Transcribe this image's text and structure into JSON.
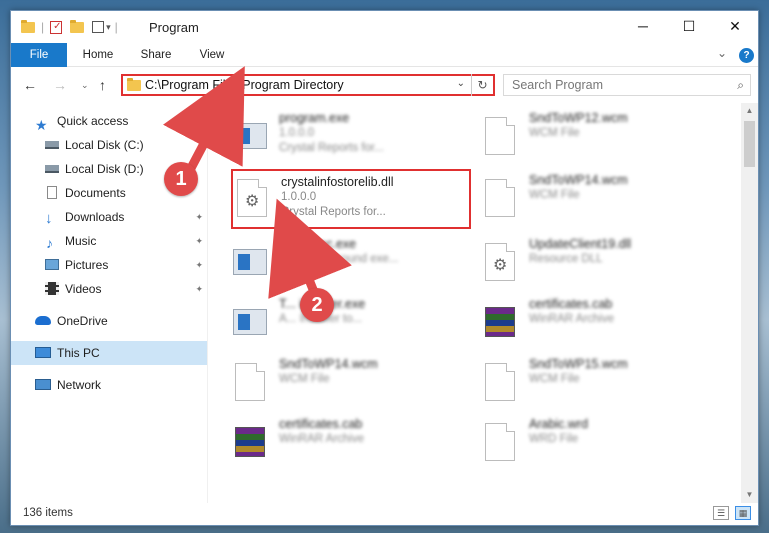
{
  "window": {
    "title": "Program",
    "min_glyph": "─",
    "max_glyph": "☐",
    "close_glyph": "✕"
  },
  "ribbon": {
    "tabs": [
      "File",
      "Home",
      "Share",
      "View"
    ],
    "expand_glyph": "⌄",
    "help_glyph": "?"
  },
  "navigation": {
    "back_glyph": "←",
    "forward_glyph": "→",
    "up_glyph": "↑",
    "address": "C:\\Program Files\\Program Directory",
    "dropdown_glyph": "⌄",
    "refresh_glyph": "↻",
    "search_placeholder": "Search Program",
    "search_glyph": "⌕"
  },
  "sidebar": {
    "items": [
      {
        "label": "Quick access",
        "icon": "star-icon"
      },
      {
        "label": "Local Disk (C:)",
        "icon": "drive-icon"
      },
      {
        "label": "Local Disk (D:)",
        "icon": "drive-icon"
      },
      {
        "label": "Documents",
        "icon": "documents-icon"
      },
      {
        "label": "Downloads",
        "icon": "download-icon"
      },
      {
        "label": "Music",
        "icon": "music-icon"
      },
      {
        "label": "Pictures",
        "icon": "pictures-icon"
      },
      {
        "label": "Videos",
        "icon": "videos-icon"
      },
      {
        "label": "OneDrive",
        "icon": "cloud-icon"
      },
      {
        "label": "This PC",
        "icon": "computer-icon"
      },
      {
        "label": "Network",
        "icon": "network-icon"
      }
    ],
    "pin_glyph": "📌"
  },
  "files": {
    "left": [
      {
        "name": "program.exe",
        "sub1": "1.0.0.0",
        "sub2": "Crystal Reports for..."
      },
      {
        "name": "crystalinfostorelib.dll",
        "sub1": "1.0.0.0",
        "sub2": "Crystal Reports for..."
      },
      {
        "name": "...ApExec.exe",
        "sub1": "...BY background exe...",
        "sub2": ""
      },
      {
        "name": "T... installer.exe",
        "sub1": "A... Installer to...",
        "sub2": ""
      },
      {
        "name": "SndToWP14.wcm",
        "sub1": "WCM File",
        "sub2": ""
      },
      {
        "name": "certificates.cab",
        "sub1": "WinRAR Archive",
        "sub2": ""
      }
    ],
    "right": [
      {
        "name": "SndToWP12.wcm",
        "sub1": "WCM File",
        "sub2": ""
      },
      {
        "name": "SndToWP14.wcm",
        "sub1": "WCM File",
        "sub2": ""
      },
      {
        "name": "UpdateClient19.dll",
        "sub1": "Resource DLL",
        "sub2": ""
      },
      {
        "name": "certificates.cab",
        "sub1": "WinRAR Archive",
        "sub2": ""
      },
      {
        "name": "SndToWP15.wcm",
        "sub1": "WCM File",
        "sub2": ""
      },
      {
        "name": "Arabic.wrd",
        "sub1": "WRD File",
        "sub2": ""
      }
    ]
  },
  "status": {
    "item_count": "136 items"
  },
  "annotations": {
    "step1": "1",
    "step2": "2",
    "highlight_color": "#e03030",
    "badge_color": "#e04a4a"
  }
}
